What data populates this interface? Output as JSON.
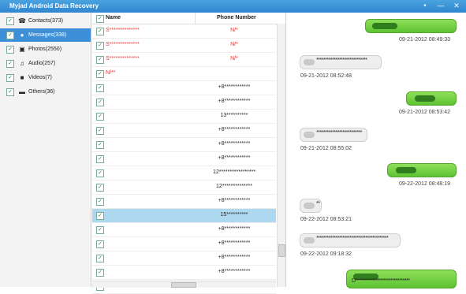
{
  "app": {
    "title": "Myjad Android Data Recovery"
  },
  "window_controls": [
    "•",
    "—",
    "✕"
  ],
  "sidebar": {
    "items": [
      {
        "label": "Contacts(373)",
        "icon": "contacts-icon",
        "glyph": "☎"
      },
      {
        "label": "Messages(338)",
        "icon": "messages-icon",
        "glyph": "●"
      },
      {
        "label": "Photos(2550)",
        "icon": "photos-icon",
        "glyph": "▣"
      },
      {
        "label": "Audio(257)",
        "icon": "audio-icon",
        "glyph": "♫"
      },
      {
        "label": "Videos(7)",
        "icon": "videos-icon",
        "glyph": "■"
      },
      {
        "label": "Others(36)",
        "icon": "folder-icon",
        "glyph": "▬"
      }
    ],
    "selected": 1
  },
  "list": {
    "col_name": "Name",
    "col_phone": "Phone Number",
    "rows": [
      {
        "name": "S**************",
        "phone": "N/*"
      },
      {
        "name": "S**************",
        "phone": "N/*"
      },
      {
        "name": "S**************",
        "phone": "N/*"
      },
      {
        "name": "N/**",
        "phone": ""
      },
      {
        "name": "",
        "phone": "+8************"
      },
      {
        "name": "",
        "phone": "+8************"
      },
      {
        "name": "",
        "phone": "13**********"
      },
      {
        "name": "",
        "phone": "+8************"
      },
      {
        "name": "",
        "phone": "+8************"
      },
      {
        "name": "",
        "phone": "+8************"
      },
      {
        "name": "",
        "phone": "12*****************"
      },
      {
        "name": "",
        "phone": "12**************"
      },
      {
        "name": "",
        "phone": "+8************"
      },
      {
        "name": "",
        "phone": "15**********"
      },
      {
        "name": "",
        "phone": "+8************"
      },
      {
        "name": "",
        "phone": "+8************"
      },
      {
        "name": "",
        "phone": "+8************"
      },
      {
        "name": "",
        "phone": "+8************"
      },
      {
        "name": "",
        "phone": "12*********"
      }
    ],
    "selected_row": 13
  },
  "chat": {
    "messages": [
      {
        "dir": "out",
        "text": "",
        "time": "09-21-2012 08:49:33"
      },
      {
        "dir": "in",
        "text": "*****************************",
        "time": "09-21-2012 08:52:48"
      },
      {
        "dir": "out",
        "text": "",
        "time": "09-21-2012 08:53:42"
      },
      {
        "dir": "in",
        "text": "**************************",
        "time": "09-21-2012 08:55:02"
      },
      {
        "dir": "out",
        "text": "",
        "time": "09-22-2012 08:48:19"
      },
      {
        "dir": "in",
        "text": "**",
        "time": "09-22-2012 08:53:21"
      },
      {
        "dir": "in",
        "text": "*****************************************",
        "time": "09-22-2012 09:18:32"
      },
      {
        "dir": "out",
        "text": "D*******************************",
        "time": ""
      }
    ]
  }
}
